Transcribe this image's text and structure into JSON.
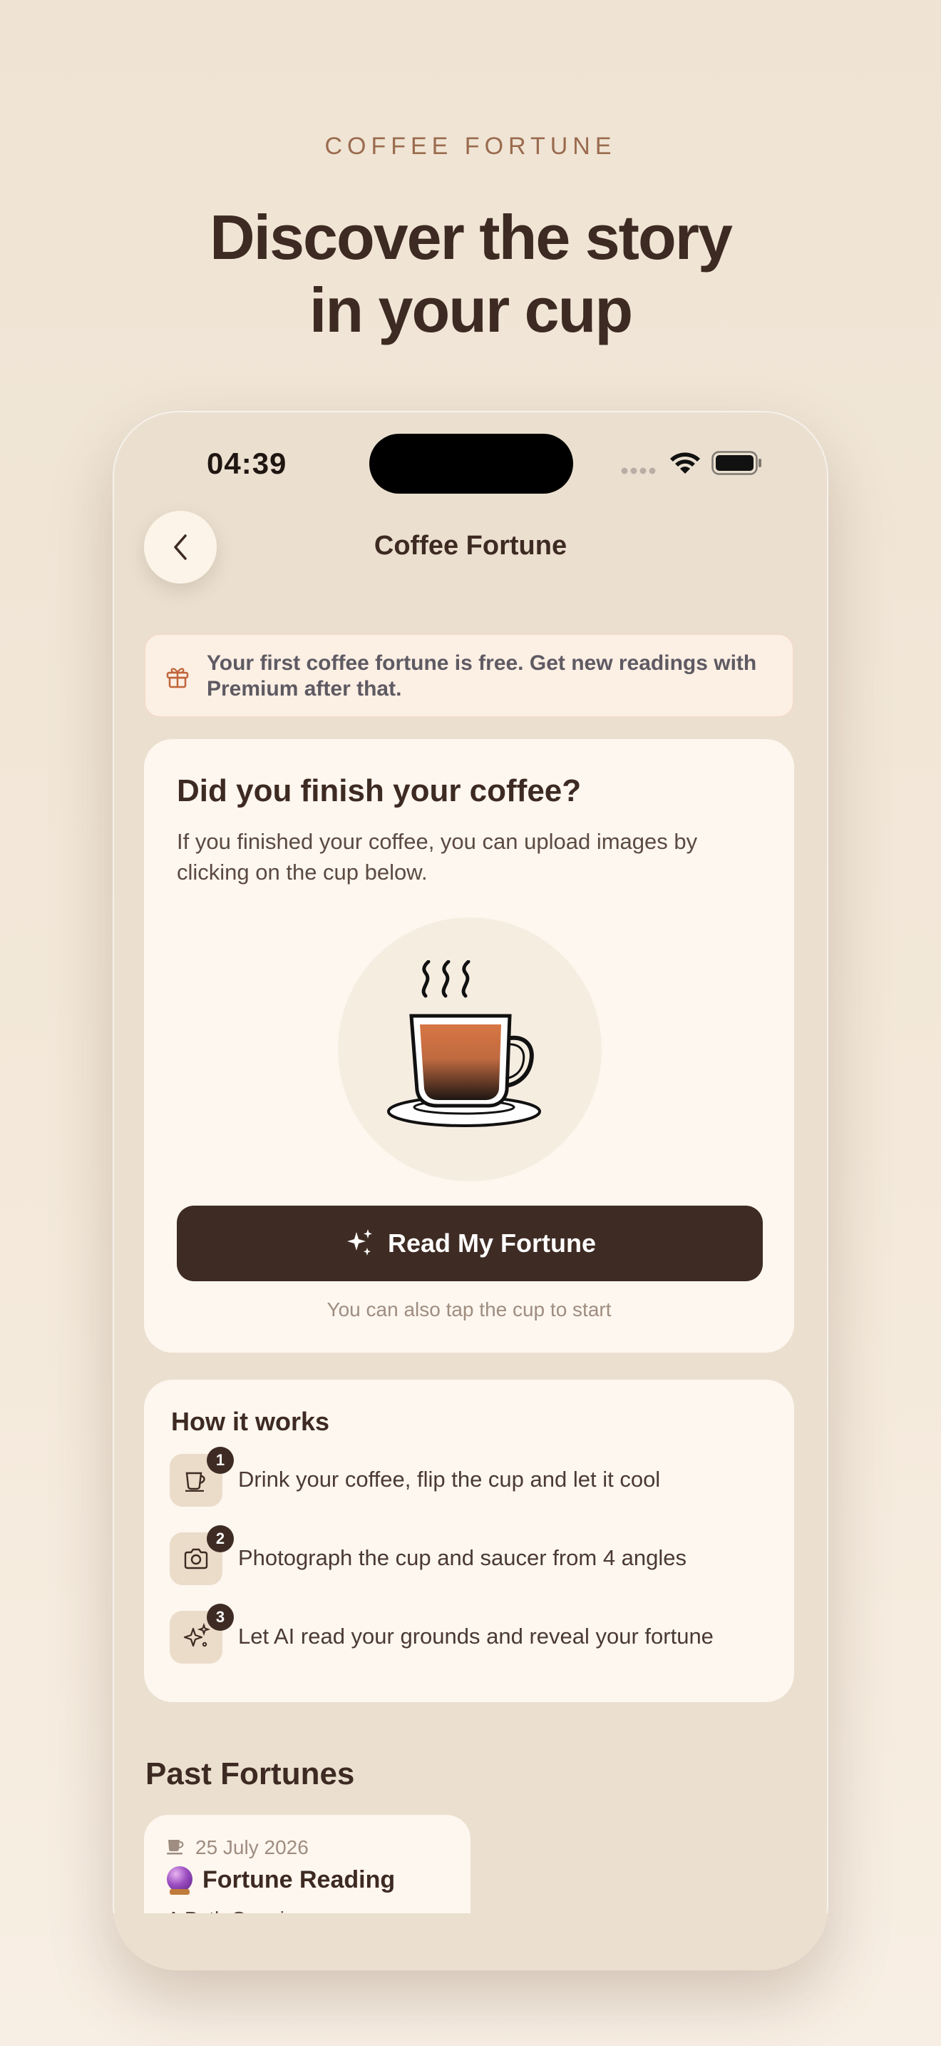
{
  "promo": {
    "eyebrow": "COFFEE FORTUNE",
    "headline_line1": "Discover the story",
    "headline_line2": "in your cup"
  },
  "status_bar": {
    "time": "04:39"
  },
  "nav": {
    "title": "Coffee Fortune",
    "back_icon": "chevron-left-icon"
  },
  "banner": {
    "icon": "gift-icon",
    "text": "Your first coffee fortune is free. Get new readings with Premium after that."
  },
  "main_card": {
    "title": "Did you finish your coffee?",
    "description": "If you finished your coffee, you can upload images by clicking on the cup below.",
    "cup_icon": "coffee-cup-icon",
    "button_label": "Read My Fortune",
    "button_icon": "sparkles-icon",
    "hint": "You can also tap the cup to start"
  },
  "how_it_works": {
    "title": "How it works",
    "steps": [
      {
        "number": "1",
        "icon": "cup-icon",
        "text": "Drink your coffee, flip the cup and let it cool"
      },
      {
        "number": "2",
        "icon": "camera-icon",
        "text": "Photograph the cup and saucer from 4 angles"
      },
      {
        "number": "3",
        "icon": "sparkles-icon",
        "text": "Let AI read your grounds and reveal your fortune"
      }
    ]
  },
  "past_fortunes": {
    "title": "Past Fortunes",
    "items": [
      {
        "date": "25 July 2026",
        "title": "Fortune Reading",
        "subtitle": "A Path Opening"
      }
    ]
  },
  "colors": {
    "background": "#EFE4D4",
    "card": "#FEF7EF",
    "primary_button": "#3E2B23",
    "accent": "#9A6B4E",
    "banner_bg": "#FCEFE4"
  }
}
